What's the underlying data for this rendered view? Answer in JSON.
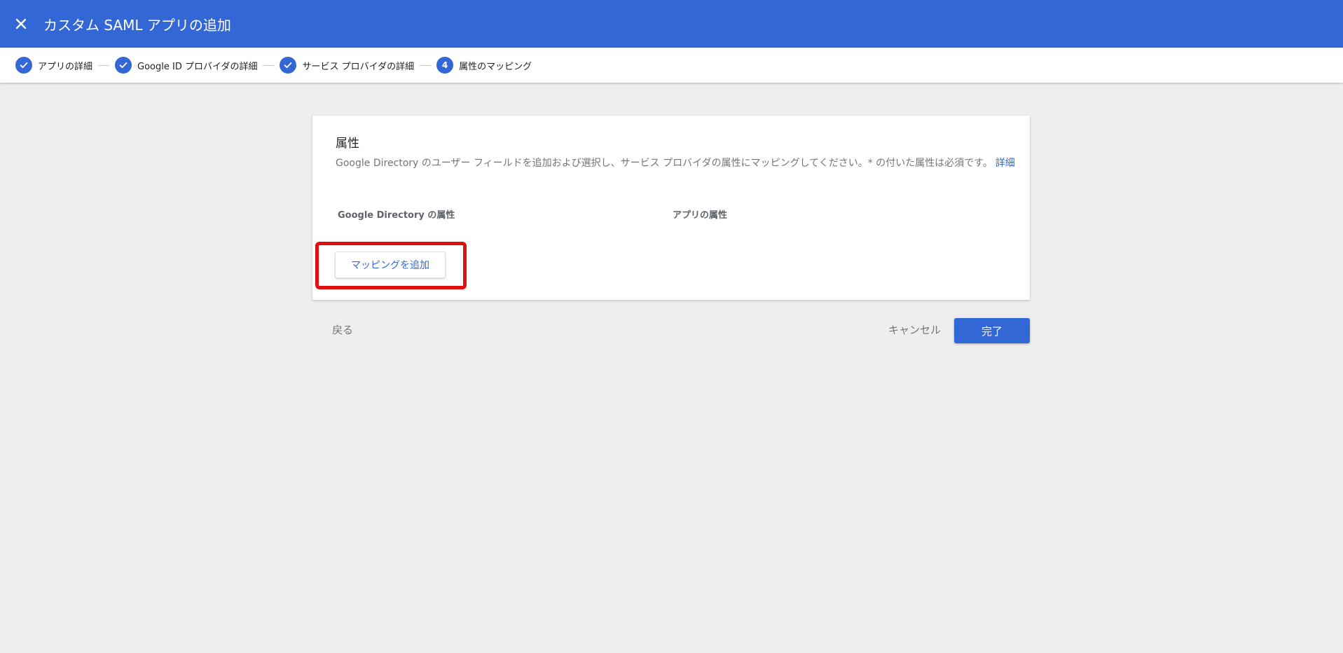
{
  "colors": {
    "appbar": "#3367d6",
    "accent": "#3367d6",
    "background": "#eeeeee",
    "highlight": "#e01010"
  },
  "appbar": {
    "close_icon": "close-icon",
    "title": "カスタム SAML アプリの追加"
  },
  "stepper": {
    "steps": [
      {
        "label": "アプリの詳細",
        "state": "complete",
        "icon": "check-icon"
      },
      {
        "label": "Google ID プロバイダの詳細",
        "state": "complete",
        "icon": "check-icon"
      },
      {
        "label": "サービス プロバイダの詳細",
        "state": "complete",
        "icon": "check-icon"
      },
      {
        "label": "属性のマッピング",
        "state": "active",
        "number": "4"
      }
    ]
  },
  "card": {
    "title": "属性",
    "description": "Google Directory のユーザー フィールドを追加および選択し、サービス プロバイダの属性にマッピングしてください。* の付いた属性は必須です。",
    "details_link": "詳細",
    "columns": {
      "left": "Google Directory の属性",
      "right": "アプリの属性"
    },
    "add_mapping_label": "マッピングを追加"
  },
  "footer": {
    "back_label": "戻る",
    "cancel_label": "キャンセル",
    "done_label": "完了"
  }
}
